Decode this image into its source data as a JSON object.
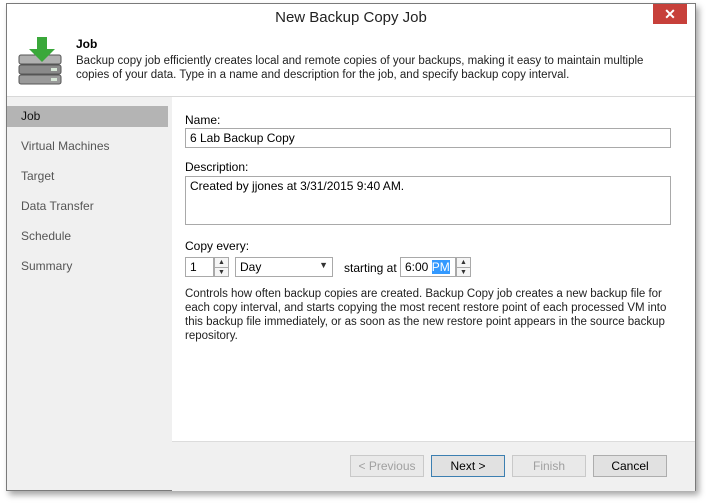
{
  "window": {
    "title": "New Backup Copy Job",
    "close_glyph": "✕"
  },
  "header": {
    "title": "Job",
    "description": "Backup copy job efficiently creates local and remote copies of your backups, making it easy to maintain multiple copies of your data. Type in a name and description for the job, and specify backup copy interval.",
    "icon": "backup-server-download-icon"
  },
  "sidebar": {
    "items": [
      {
        "label": "Job",
        "active": true
      },
      {
        "label": "Virtual Machines",
        "active": false
      },
      {
        "label": "Target",
        "active": false
      },
      {
        "label": "Data Transfer",
        "active": false
      },
      {
        "label": "Schedule",
        "active": false
      },
      {
        "label": "Summary",
        "active": false
      }
    ]
  },
  "form": {
    "name_label": "Name:",
    "name_value": "6 Lab Backup Copy",
    "description_label": "Description:",
    "description_value": "Created by jjones at 3/31/2015 9:40 AM.",
    "copy_every_label": "Copy every:",
    "interval_value": "1",
    "interval_unit": "Day",
    "starting_at_label": "starting at",
    "start_time_hour": "6:00",
    "start_time_ampm": "PM",
    "help_text": "Controls how often backup copies are created. Backup Copy job creates a new backup file for each copy interval, and starts copying the most recent restore point of each processed VM into this backup file immediately, or as soon as the new restore point appears in the source backup repository."
  },
  "buttons": {
    "previous": "< Previous",
    "next": "Next >",
    "finish": "Finish",
    "cancel": "Cancel"
  },
  "colors": {
    "close_button": "#c7403a",
    "sidebar_active": "#b4b4b4",
    "selection": "#3399ff"
  }
}
